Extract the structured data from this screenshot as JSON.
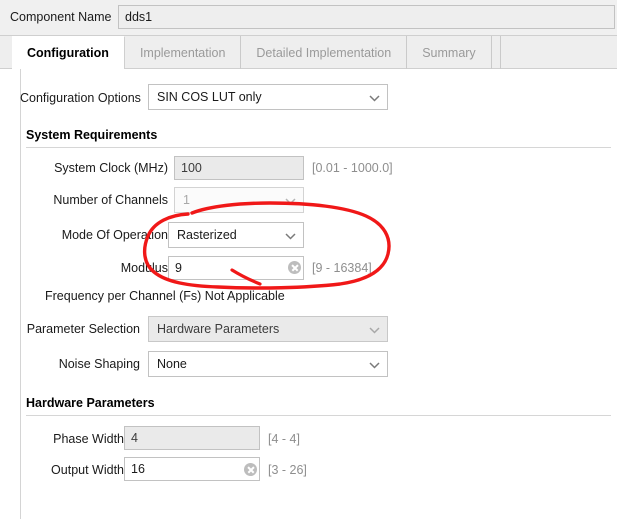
{
  "header": {
    "component_name_label": "Component Name",
    "component_name_value": "dds1"
  },
  "tabs": [
    {
      "label": "Configuration",
      "active": true
    },
    {
      "label": "Implementation",
      "active": false
    },
    {
      "label": "Detailed Implementation",
      "active": false
    },
    {
      "label": "Summary",
      "active": false
    }
  ],
  "config_options": {
    "label": "Configuration Options",
    "value": "SIN COS LUT only",
    "chevron_icon": "chevron-down-icon"
  },
  "system_requirements": {
    "section_title": "System Requirements",
    "system_clock": {
      "label": "System Clock (MHz)",
      "value": "100",
      "hint": "[0.01 - 1000.0]"
    },
    "num_channels": {
      "label": "Number of Channels",
      "value": "1",
      "chevron_icon": "chevron-down-icon"
    },
    "mode_of_operation": {
      "label": "Mode Of Operation",
      "value": "Rasterized",
      "chevron_icon": "chevron-down-icon"
    },
    "modulus": {
      "label": "Modulus",
      "value": "9",
      "hint": "[9 - 16384]",
      "clear_icon": "clear-circle-x-icon"
    },
    "frequency_per_channel": "Frequency per Channel (Fs) Not Applicable"
  },
  "parameter_selection": {
    "label": "Parameter Selection",
    "value": "Hardware Parameters",
    "chevron_icon": "chevron-down-icon"
  },
  "noise_shaping": {
    "label": "Noise Shaping",
    "value": "None",
    "chevron_icon": "chevron-down-icon"
  },
  "hardware_parameters": {
    "section_title": "Hardware Parameters",
    "phase_width": {
      "label": "Phase Width",
      "value": "4",
      "hint": "[4 - 4]"
    },
    "output_width": {
      "label": "Output Width",
      "value": "16",
      "hint": "[3 - 26]",
      "clear_icon": "clear-circle-x-icon"
    }
  },
  "annotation": {
    "type": "hand-drawn-red-ellipse",
    "color": "#f01818"
  }
}
